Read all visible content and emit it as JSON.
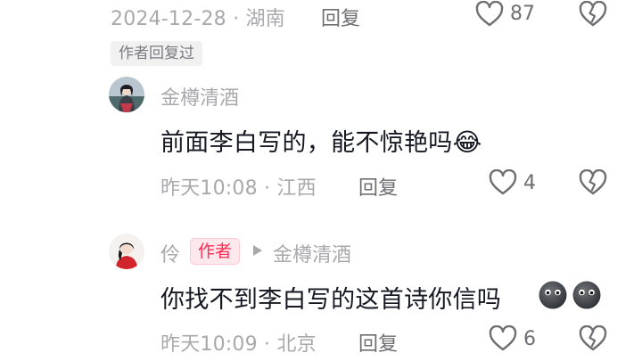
{
  "parent_comment": {
    "date": "2024-12-28",
    "location": "湖南",
    "reply_label": "回复",
    "like_count": "87"
  },
  "author_replied_tag": "作者回复过",
  "replies": [
    {
      "username": "金樽清酒",
      "text": "前面李白写的，能不惊艳吗",
      "emoji": "😂",
      "time": "昨天10:08",
      "location": "江西",
      "reply_label": "回复",
      "like_count": "4"
    },
    {
      "username": "伶",
      "author_badge": "作者",
      "reply_to": "金樽清酒",
      "text": "你找不到李白写的这首诗你信吗",
      "time": "昨天10:09",
      "location": "北京",
      "reply_label": "回复",
      "like_count": "6"
    }
  ],
  "meta_separator": "·",
  "colors": {
    "accent": "#fe2c55",
    "muted_text": "#a9a9ad",
    "primary_text": "#161823"
  },
  "icons": {
    "like": "heart-outline-icon",
    "dislike": "broken-heart-icon",
    "reply_arrow": "play-triangle-icon"
  }
}
